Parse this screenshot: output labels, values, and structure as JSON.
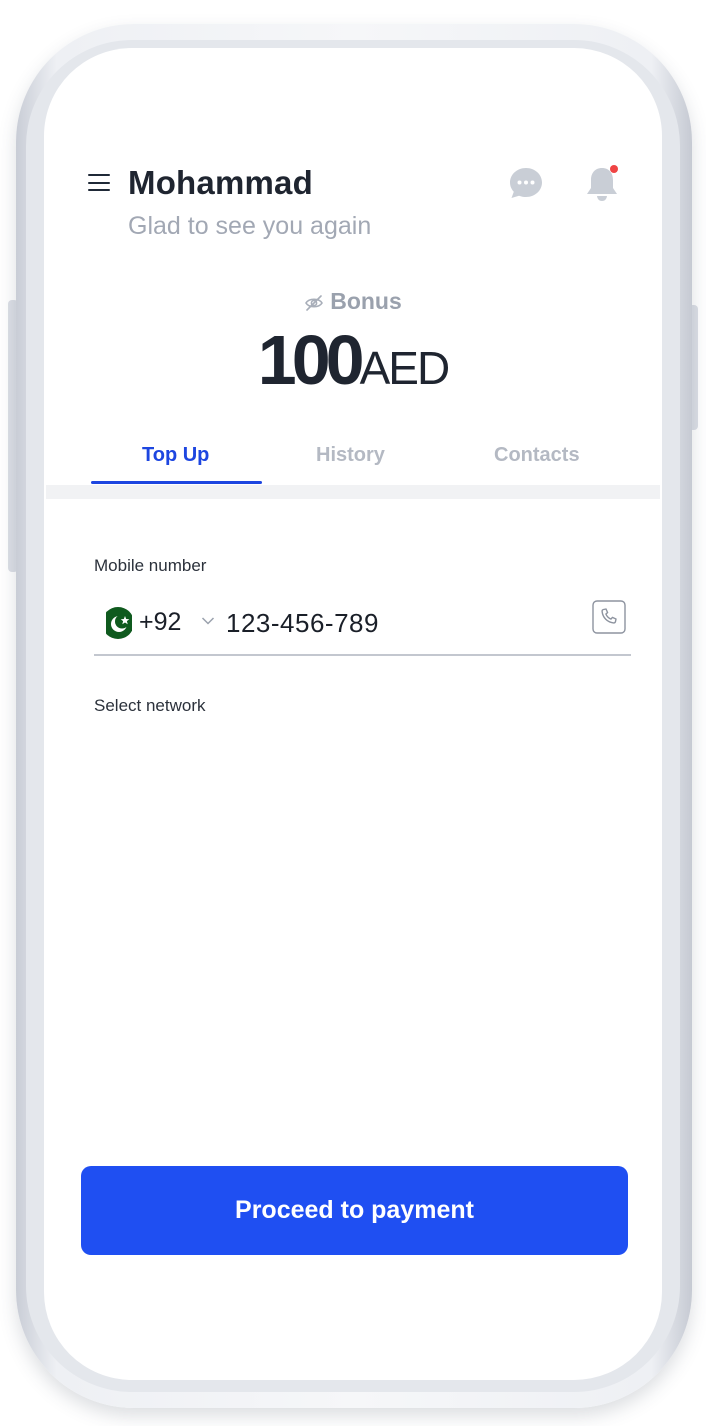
{
  "header": {
    "user_name": "Mohammad",
    "greeting": "Glad to see you again",
    "icons": {
      "menu": "menu-icon",
      "chat": "chat-icon",
      "notifications": "bell-icon"
    },
    "notification_dot_color": "#ef4444"
  },
  "balance": {
    "label": "Bonus",
    "amount": "100",
    "currency": "AED",
    "visibility_icon": "eye-off-icon"
  },
  "tabs": [
    {
      "label": "Top Up",
      "active": true
    },
    {
      "label": "History",
      "active": false
    },
    {
      "label": "Contacts",
      "active": false
    }
  ],
  "form": {
    "mobile_label": "Mobile number",
    "country_flag": "pakistan-flag-icon",
    "dial_code": "+92",
    "phone_number": "123-456-789",
    "contact_icon": "phone-book-icon",
    "network_label": "Select network"
  },
  "cta": {
    "label": "Proceed to payment"
  },
  "colors": {
    "accent": "#1f4ff2",
    "tab_active": "#1d46e0",
    "muted": "#b4b9c3"
  }
}
